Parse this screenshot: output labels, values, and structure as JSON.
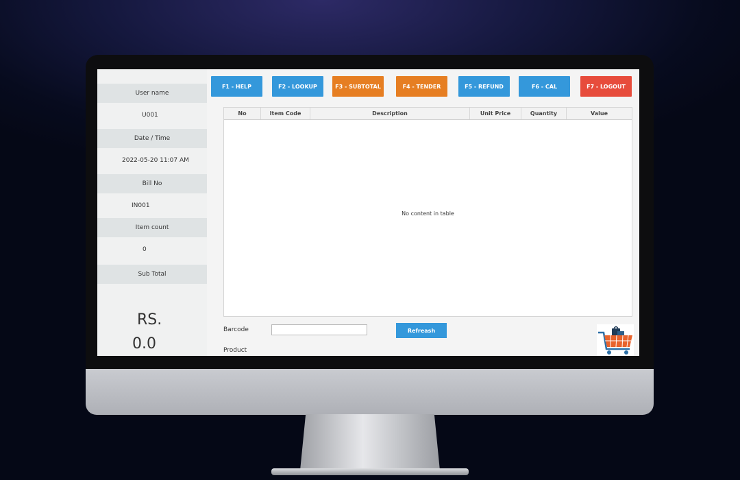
{
  "sidebar": {
    "username_label": "User name",
    "username_value": "U001",
    "datetime_label": "Date / Time",
    "datetime_value": "2022-05-20 11:07 AM",
    "billno_label": "Bill No",
    "billno_value": "IN001",
    "itemcount_label": "Item count",
    "itemcount_value": "0",
    "subtotal_label": "Sub Total",
    "currency": "RS.",
    "total_value": "0.0"
  },
  "toolbar": {
    "help": "F1 - HELP",
    "lookup": "F2 - LOOKUP",
    "subtotal": "F3 - SUBTOTAL",
    "tender": "F4 - TENDER",
    "refund": "F5 - REFUND",
    "cal": "F6 - CAL",
    "logout": "F7 - LOGOUT"
  },
  "table": {
    "columns": [
      "No",
      "Item Code",
      "Description",
      "Unit Price",
      "Quantity",
      "Value"
    ],
    "empty_message": "No content in table"
  },
  "bottom": {
    "barcode_label": "Barcode",
    "barcode_value": "",
    "refresh_label": "Refreash",
    "product_label": "Product"
  },
  "colors": {
    "button_blue": "#3498db",
    "button_orange": "#e67e22",
    "button_red": "#e74c3c"
  },
  "icons": {
    "cart": "shopping-cart-icon"
  }
}
